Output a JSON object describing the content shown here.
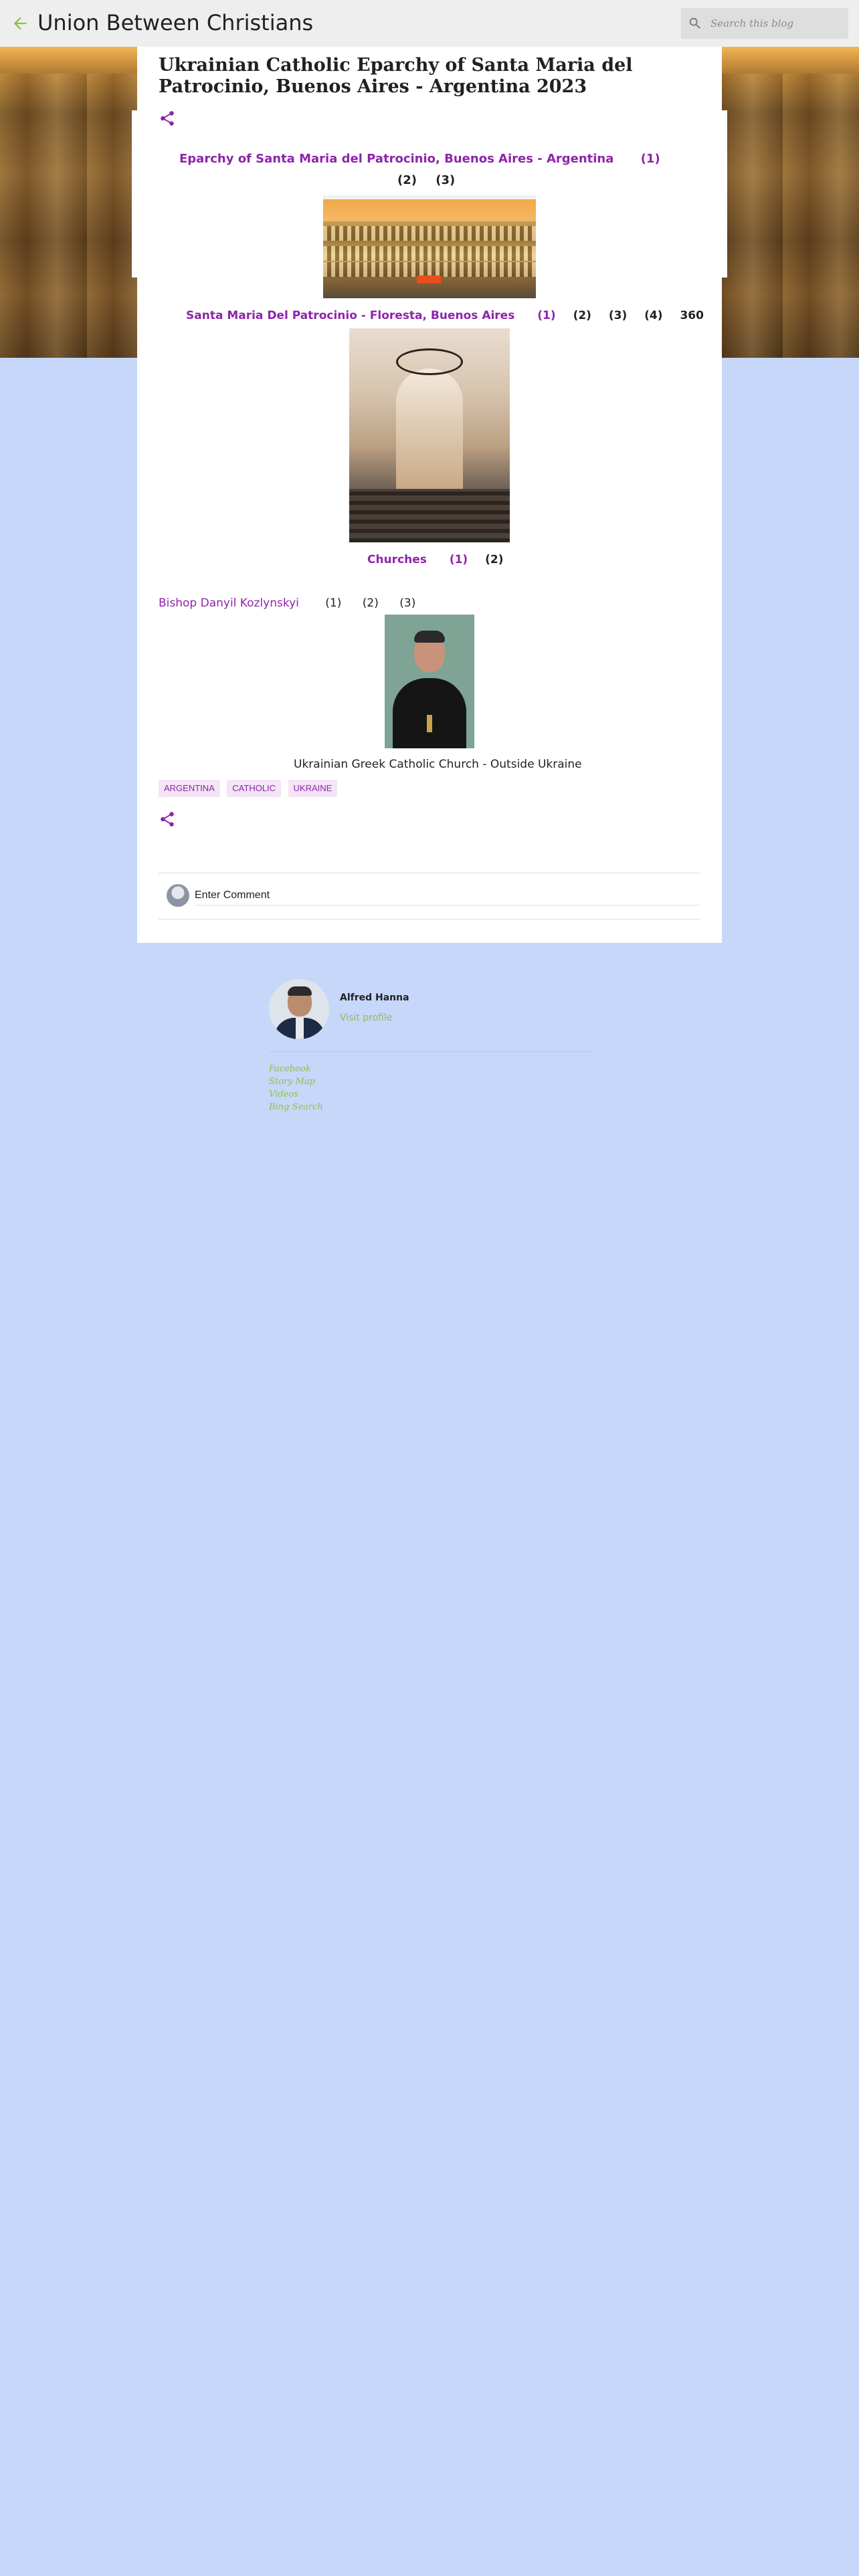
{
  "header": {
    "blog_title": "Union Between Christians",
    "search_placeholder": "Search this blog"
  },
  "post": {
    "title": "Ukrainian Catholic Eparchy of Santa Maria del Patrocinio, Buenos Aires - Argentina 2023",
    "eparchy_line": {
      "link": "Eparchy of Santa Maria del Patrocinio, Buenos Aires - Argentina",
      "refs": [
        "(1)",
        "(2)",
        "(3)"
      ]
    },
    "church_line": {
      "link": "Santa Maria Del Patrocinio - Floresta, Buenos Aires",
      "refs": [
        "(1)",
        "(2)",
        "(3)",
        "(4)",
        "360"
      ]
    },
    "churches_line": {
      "link": "Churches",
      "refs": [
        "(1)",
        "(2)"
      ]
    },
    "bishop_line": {
      "link": "Bishop Danyil Kozlynskyi",
      "refs": [
        "(1)",
        "(2)",
        "(3)"
      ]
    },
    "outside_link": "Ukrainian Greek Catholic Church - Outside Ukraine",
    "labels": [
      "ARGENTINA",
      "CATHOLIC",
      "UKRAINE"
    ],
    "comment_placeholder": "Enter Comment"
  },
  "profile": {
    "name": "Alfred Hanna",
    "visit_label": "Visit profile"
  },
  "footer_links": [
    "Facebook",
    "Story Map",
    "Videos",
    "Bing Search"
  ],
  "colors": {
    "accent": "#8e24aa",
    "link_green": "#8bc34a",
    "page_background": "#c6d7f9"
  }
}
